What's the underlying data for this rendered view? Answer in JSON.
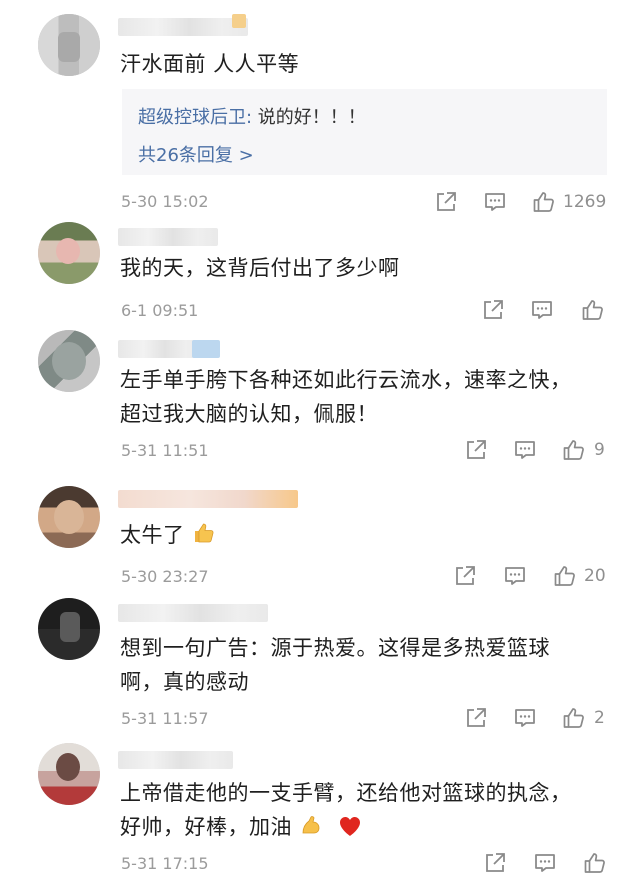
{
  "comments": [
    {
      "text": "汗水面前 人人平等",
      "reply_author": "超级控球后卫",
      "reply_sep": ": ",
      "reply_text": "说的好！！！",
      "reply_more": "共26条回复 >",
      "time": "5-30 15:02",
      "likes": "1269"
    },
    {
      "text": "我的天，这背后付出了多少啊",
      "time": "6-1 09:51",
      "likes": ""
    },
    {
      "text_line1": "左手单手胯下各种还如此行云流水，速率之快，",
      "text_line2": "超过我大脑的认知，佩服！",
      "time": "5-31 11:51",
      "likes": "9"
    },
    {
      "text": "太牛了",
      "time": "5-30 23:27",
      "likes": "20"
    },
    {
      "text_line1": "想到一句广告：源于热爱。这得是多热爱篮球",
      "text_line2": "啊，真的感动",
      "time": "5-31 11:57",
      "likes": "2"
    },
    {
      "text_line1": "上帝借走他的一支手臂，还给他对篮球的执念，",
      "text_line2": "好帅，好棒，加油",
      "time": "5-31 17:15",
      "likes": ""
    }
  ],
  "colors": {
    "link": "#4a6fa5",
    "meta": "#9b9b9b",
    "icon": "#8a8a8a",
    "reply_bg": "#f6f6f8"
  },
  "icons": [
    "share-icon",
    "comment-icon",
    "like-icon",
    "thumbs-up-emoji",
    "flexed-biceps-emoji",
    "red-heart-emoji"
  ]
}
